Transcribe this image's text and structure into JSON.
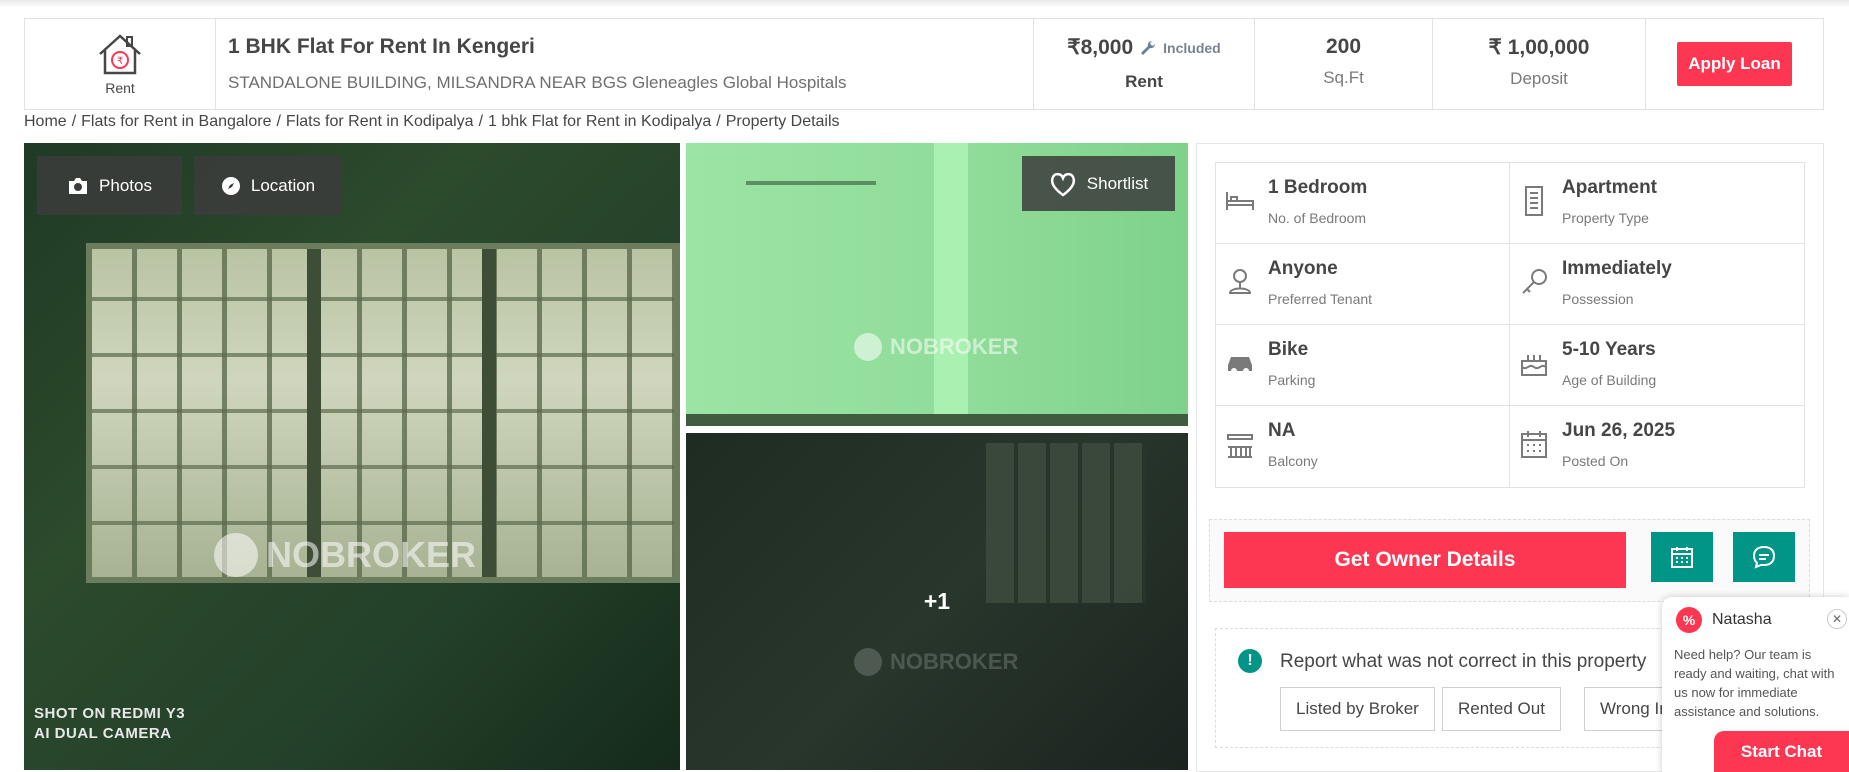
{
  "header": {
    "type_label": "Rent",
    "title": "1 BHK Flat For Rent In Kengeri",
    "subtitle": "STANDALONE BUILDING, MILSANDRA NEAR BGS Gleneagles Global Hospitals",
    "rent_value": "₹8,000",
    "rent_included": "Included",
    "rent_label": "Rent",
    "area_value": "200",
    "area_label": "Sq.Ft",
    "deposit_value": "₹ 1,00,000",
    "deposit_label": "Deposit",
    "apply_loan": "Apply Loan"
  },
  "breadcrumb": {
    "items": [
      "Home",
      "Flats for Rent in Bangalore",
      "Flats for Rent in Kodipalya",
      "1 bhk Flat for Rent in Kodipalya",
      "Property Details"
    ]
  },
  "gallery": {
    "photos_label": "Photos",
    "location_label": "Location",
    "shortlist_label": "Shortlist",
    "more_count": "+1",
    "watermark": "NOBROKER",
    "shot_text_1": "SHOT ON REDMI Y3",
    "shot_text_2": "AI DUAL CAMERA"
  },
  "facts": [
    {
      "value": "1 Bedroom",
      "label": "No. of Bedroom",
      "icon": "bed-icon"
    },
    {
      "value": "Apartment",
      "label": "Property Type",
      "icon": "building-icon"
    },
    {
      "value": "Anyone",
      "label": "Preferred Tenant",
      "icon": "tenant-icon"
    },
    {
      "value": "Immediately",
      "label": "Possession",
      "icon": "key-icon"
    },
    {
      "value": "Bike",
      "label": "Parking",
      "icon": "car-icon"
    },
    {
      "value": "5-10 Years",
      "label": "Age of Building",
      "icon": "cake-icon"
    },
    {
      "value": "NA",
      "label": "Balcony",
      "icon": "balcony-icon"
    },
    {
      "value": "Jun 26, 2025",
      "label": "Posted On",
      "icon": "calendar-icon"
    }
  ],
  "actions": {
    "get_owner": "Get Owner Details"
  },
  "report": {
    "text": "Report what was not correct in this property",
    "buttons": [
      "Listed by Broker",
      "Rented Out",
      "Wrong Info"
    ]
  },
  "chat": {
    "name": "Natasha",
    "message": "Need help? Our team is ready and waiting, chat with us now for immediate assistance and solutions.",
    "start": "Start Chat"
  },
  "colors": {
    "brand": "#fd3752",
    "teal": "#009587"
  }
}
